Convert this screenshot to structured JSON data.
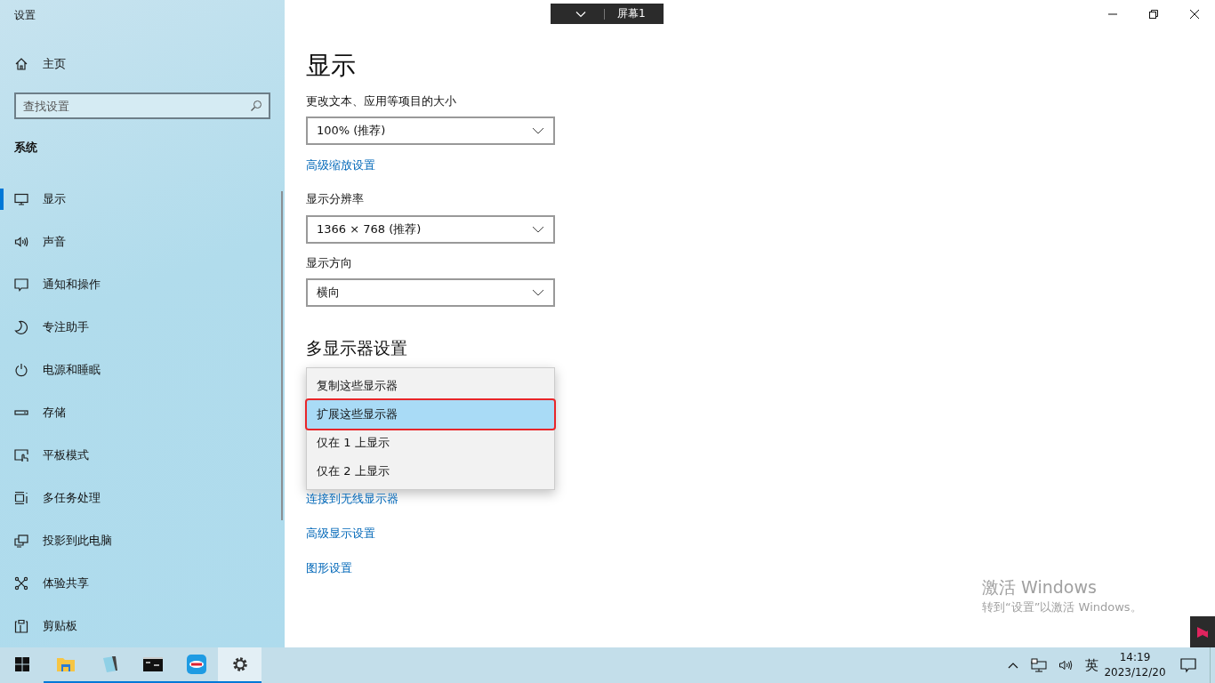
{
  "window": {
    "title": "设置"
  },
  "display_tab": {
    "label": "屏幕1"
  },
  "sidebar": {
    "home": "主页",
    "search": {
      "placeholder": "查找设置"
    },
    "section": "系统",
    "items": [
      {
        "label": "显示",
        "selected": true
      },
      {
        "label": "声音",
        "selected": false
      },
      {
        "label": "通知和操作",
        "selected": false
      },
      {
        "label": "专注助手",
        "selected": false
      },
      {
        "label": "电源和睡眠",
        "selected": false
      },
      {
        "label": "存储",
        "selected": false
      },
      {
        "label": "平板模式",
        "selected": false
      },
      {
        "label": "多任务处理",
        "selected": false
      },
      {
        "label": "投影到此电脑",
        "selected": false
      },
      {
        "label": "体验共享",
        "selected": false
      },
      {
        "label": "剪贴板",
        "selected": false
      }
    ]
  },
  "content": {
    "title": "显示",
    "scale": {
      "label": "更改文本、应用等项目的大小",
      "value": "100% (推荐)"
    },
    "scale_link": "高级缩放设置",
    "resolution": {
      "label": "显示分辨率",
      "value": "1366 × 768 (推荐)"
    },
    "orientation": {
      "label": "显示方向",
      "value": "横向"
    },
    "multi_heading": "多显示器设置",
    "multi_menu": [
      {
        "label": "复制这些显示器",
        "selected": false,
        "outlined": false
      },
      {
        "label": "扩展这些显示器",
        "selected": true,
        "outlined": true
      },
      {
        "label": "仅在 1 上显示",
        "selected": false,
        "outlined": false
      },
      {
        "label": "仅在 2 上显示",
        "selected": false,
        "outlined": false
      }
    ],
    "links": [
      "连接到无线显示器",
      "高级显示设置",
      "图形设置"
    ]
  },
  "activation": {
    "title": "激活 Windows",
    "text": "转到“设置”以激活 Windows。"
  },
  "taskbar": {
    "apps": [
      {
        "running": true,
        "active": false
      },
      {
        "running": true,
        "active": false
      },
      {
        "running": true,
        "active": false
      },
      {
        "running": true,
        "active": false
      },
      {
        "running": true,
        "active": true
      }
    ],
    "ime": "英",
    "time": "14:19",
    "date": "2023/12/20"
  }
}
